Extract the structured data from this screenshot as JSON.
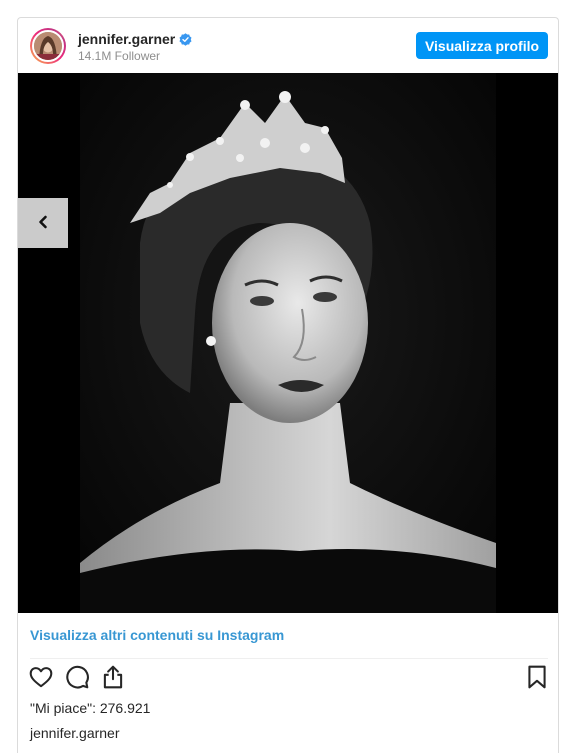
{
  "post": {
    "username": "jennifer.garner",
    "followers": "14.1M Follower",
    "profile_button": "Visualizza profilo",
    "more_link": "Visualizza altri contenuti su Instagram",
    "likes": "\"Mi piace\": 276.921",
    "caption_username": "jennifer.garner"
  },
  "icons": {
    "verified": "verified-badge-icon",
    "prev": "chevron-left-icon",
    "like": "heart-icon",
    "comment": "comment-icon",
    "share": "share-icon",
    "save": "bookmark-icon"
  },
  "colors": {
    "accent": "#0095f6",
    "link": "#3897d3",
    "text": "#262626",
    "muted": "#8e8e8e"
  }
}
